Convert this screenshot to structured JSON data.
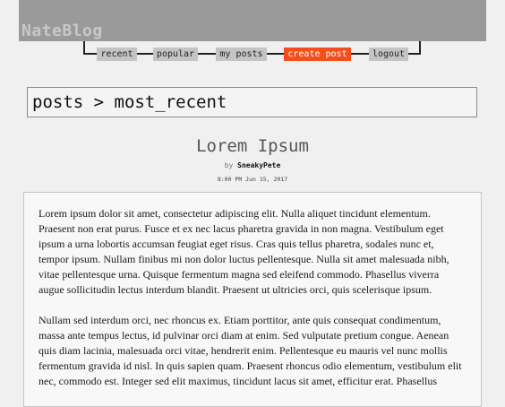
{
  "header": {
    "logo": "NateBlog"
  },
  "nav": {
    "recent": "recent",
    "popular": "popular",
    "my_posts": "my posts",
    "create_post": "create post",
    "logout": "logout"
  },
  "breadcrumb": "posts > most_recent",
  "post": {
    "title": "Lorem Ipsum",
    "by": "by",
    "author": "SneakyPete",
    "date": "8:00 PM Jun 15, 2017",
    "paragraphs": [
      "Lorem ipsum dolor sit amet, consectetur adipiscing elit. Nulla aliquet tincidunt elementum. Praesent non erat purus. Fusce et ex nec lacus pharetra gravida in non magna. Vestibulum eget ipsum a urna lobortis accumsan feugiat eget risus. Cras quis tellus pharetra, sodales nunc et, tempor ipsum. Nullam finibus mi non dolor luctus pellentesque. Nulla sit amet malesuada nibh, vitae pellentesque urna. Quisque fermentum magna sed eleifend commodo. Phasellus viverra augue sollicitudin lectus interdum blandit. Praesent ut ultricies orci, quis scelerisque ipsum.",
      "Nullam sed interdum orci, nec rhoncus ex. Etiam porttitor, ante quis consequat condimentum, massa ante tempus lectus, id pulvinar orci diam at enim. Sed vulputate pretium congue. Aenean quis diam lacinia, malesuada orci vitae, hendrerit enim. Pellentesque eu mauris vel nunc mollis fermentum gravida id nisl. In quis sapien quam. Praesent rhoncus odio elementum, vestibulum elit nec, commodo est. Integer sed elit maximus, tincidunt lacus sit amet, efficitur erat. Phasellus"
    ]
  },
  "colors": {
    "header_bg": "#9a9a9a",
    "nav_active": "#f24f1c",
    "nav_item_bg": "#c4c4c4",
    "page_bg": "#f0f0f0"
  }
}
